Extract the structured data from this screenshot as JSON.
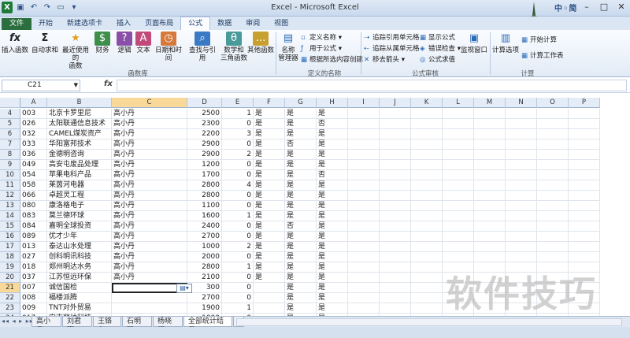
{
  "window": {
    "title": "Excel - Microsoft Excel",
    "ime_text": "中◦简"
  },
  "tabs": [
    "文件",
    "开始",
    "新建选项卡",
    "插入",
    "页面布局",
    "公式",
    "数据",
    "审阅",
    "视图"
  ],
  "ribbon": {
    "insert_function": "插入函数",
    "autosum": "自动求和",
    "recent_line1": "最近使用的",
    "recent_line2": "函数",
    "financial": "财务",
    "logical": "逻辑",
    "text": "文本",
    "datetime": "日期和时间",
    "lookup": "查找与引用",
    "math_line1": "数学和",
    "math_line2": "三角函数",
    "more": "其他函数",
    "group_library": "函数库",
    "name_manager_line1": "名称",
    "name_manager_line2": "管理器",
    "define_name": "定义名称 ▾",
    "use_in_formula": "用于公式 ▾",
    "create_from_sel": "根据所选内容创建",
    "group_names": "定义的名称",
    "trace_precedents": "追踪引用单元格",
    "trace_dependents": "追踪从属单元格",
    "remove_arrows": "移去箭头 ▾",
    "show_formulas": "显示公式",
    "error_check": "错误检查 ▾",
    "evaluate": "公式求值",
    "watch_window": "监视窗口",
    "group_auditing": "公式审核",
    "calc_options": "计算选项",
    "calc_now": "开始计算",
    "calc_sheet": "计算工作表",
    "group_calc": "计算"
  },
  "formula_bar": {
    "name_box": "C21",
    "fx": "fx",
    "value": ""
  },
  "columns": [
    "A",
    "B",
    "C",
    "D",
    "E",
    "F",
    "G",
    "H",
    "I",
    "J",
    "K",
    "L",
    "M",
    "N",
    "O",
    "P"
  ],
  "rows": [
    {
      "n": "4",
      "a": "003",
      "b": "北京卡罗里尼",
      "c": "高小丹",
      "d": "2500",
      "e": "1",
      "f": "是",
      "g": "是",
      "h": "是"
    },
    {
      "n": "5",
      "a": "026",
      "b": "太阳联通信息技术",
      "c": "高小丹",
      "d": "2300",
      "e": "0",
      "f": "是",
      "g": "是",
      "h": "否"
    },
    {
      "n": "6",
      "a": "032",
      "b": "CAMEL煤炭资产",
      "c": "高小丹",
      "d": "2200",
      "e": "3",
      "f": "是",
      "g": "是",
      "h": "是"
    },
    {
      "n": "7",
      "a": "033",
      "b": "华阳富邦技术",
      "c": "高小丹",
      "d": "2900",
      "e": "0",
      "f": "是",
      "g": "否",
      "h": "是"
    },
    {
      "n": "8",
      "a": "036",
      "b": "金德明咨询",
      "c": "高小丹",
      "d": "2900",
      "e": "2",
      "f": "是",
      "g": "是",
      "h": "是"
    },
    {
      "n": "9",
      "a": "049",
      "b": "高安屯废品处理",
      "c": "高小丹",
      "d": "1200",
      "e": "0",
      "f": "是",
      "g": "是",
      "h": "是"
    },
    {
      "n": "10",
      "a": "054",
      "b": "苹果电科产品",
      "c": "高小丹",
      "d": "1700",
      "e": "0",
      "f": "是",
      "g": "是",
      "h": "否"
    },
    {
      "n": "11",
      "a": "058",
      "b": "莱茵河电器",
      "c": "高小丹",
      "d": "2800",
      "e": "4",
      "f": "是",
      "g": "是",
      "h": "是"
    },
    {
      "n": "12",
      "a": "066",
      "b": "卓超灵工程",
      "c": "高小丹",
      "d": "2800",
      "e": "0",
      "f": "是",
      "g": "是",
      "h": "是"
    },
    {
      "n": "13",
      "a": "080",
      "b": "康洛格电子",
      "c": "高小丹",
      "d": "1100",
      "e": "0",
      "f": "是",
      "g": "是",
      "h": "是"
    },
    {
      "n": "14",
      "a": "083",
      "b": "莫兰德环球",
      "c": "高小丹",
      "d": "1600",
      "e": "1",
      "f": "是",
      "g": "是",
      "h": "是"
    },
    {
      "n": "15",
      "a": "084",
      "b": "嘉明全球投资",
      "c": "高小丹",
      "d": "2400",
      "e": "0",
      "f": "是",
      "g": "否",
      "h": "是"
    },
    {
      "n": "16",
      "a": "089",
      "b": "优才少年",
      "c": "高小丹",
      "d": "2700",
      "e": "0",
      "f": "是",
      "g": "是",
      "h": "是"
    },
    {
      "n": "17",
      "a": "013",
      "b": "泰达山水处理",
      "c": "高小丹",
      "d": "1000",
      "e": "2",
      "f": "是",
      "g": "是",
      "h": "是"
    },
    {
      "n": "18",
      "a": "027",
      "b": "创科明讯科技",
      "c": "高小丹",
      "d": "2000",
      "e": "0",
      "f": "是",
      "g": "是",
      "h": "是"
    },
    {
      "n": "19",
      "a": "018",
      "b": "郑州明达水务",
      "c": "高小丹",
      "d": "2800",
      "e": "1",
      "f": "是",
      "g": "是",
      "h": "是"
    },
    {
      "n": "20",
      "a": "037",
      "b": "江苏恒远环保",
      "c": "高小丹",
      "d": "2100",
      "e": "0",
      "f": "是",
      "g": "是",
      "h": "是"
    },
    {
      "n": "21",
      "a": "007",
      "b": "诚信国检",
      "c": "",
      "d": "300",
      "e": "0",
      "f": "",
      "g": "是",
      "h": "是"
    },
    {
      "n": "22",
      "a": "008",
      "b": "福楼派腾",
      "c": "",
      "d": "2700",
      "e": "0",
      "f": "",
      "g": "是",
      "h": "是"
    },
    {
      "n": "23",
      "a": "009",
      "b": "TNT对外贸易",
      "c": "",
      "d": "1900",
      "e": "1",
      "f": "",
      "g": "是",
      "h": "是"
    },
    {
      "n": "24",
      "a": "017",
      "b": "安吉丽纳科技",
      "c": "",
      "d": "1000",
      "e": "0",
      "f": "",
      "g": "是",
      "h": "是"
    }
  ],
  "selected_cell": "C21",
  "sheet_tabs": [
    "高小丹",
    "刘君赢",
    "王铬争",
    "石明砚",
    "杨晓柯",
    "全部统计结果"
  ],
  "active_sheet": "全部统计结果",
  "sheet_nav": "◂◂ ◂ ▸ ▸▸",
  "watermark": "软件技巧"
}
